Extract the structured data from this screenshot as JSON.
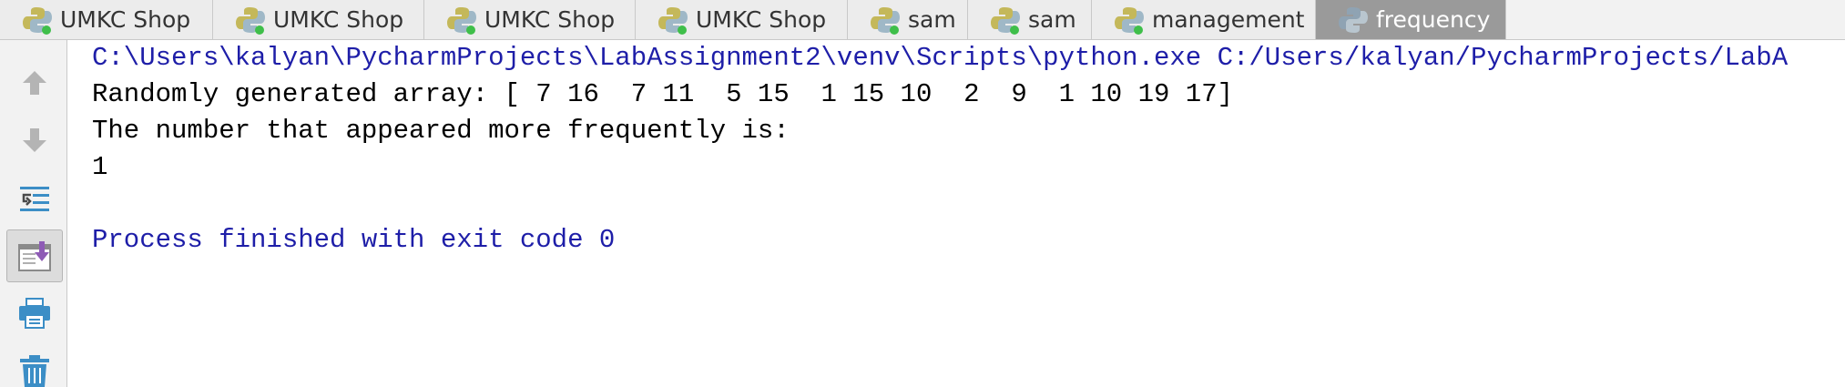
{
  "tabs": [
    {
      "label": "UMKC Shop",
      "active": false
    },
    {
      "label": "UMKC Shop",
      "active": false
    },
    {
      "label": "UMKC Shop",
      "active": false
    },
    {
      "label": "UMKC Shop",
      "active": false
    },
    {
      "label": "sam",
      "active": false
    },
    {
      "label": "sam",
      "active": false
    },
    {
      "label": "management",
      "active": false
    },
    {
      "label": "frequency",
      "active": true
    }
  ],
  "toolbar": {
    "icons": [
      "up-arrow-icon",
      "down-arrow-icon",
      "soft-wrap-icon",
      "scroll-to-end-icon",
      "print-icon",
      "trash-icon"
    ]
  },
  "console": {
    "command": "C:\\Users\\kalyan\\PycharmProjects\\LabAssignment2\\venv\\Scripts\\python.exe C:/Users/kalyan/PycharmProjects/LabA",
    "array_line": "Randomly generated array: [ 7 16  7 11  5 15  1 15 10  2  9  1 10 19 17]",
    "frequency_line": "The number that appeared more frequently is:",
    "result": "1",
    "exit_message": "Process finished with exit code 0"
  },
  "colors": {
    "console_blue": "#1e1ea8",
    "active_tab": "#9a9a9a",
    "icon_blue": "#3c8ec6",
    "icon_gray": "#9a9a9a",
    "icon_purple": "#8e5bb5"
  }
}
